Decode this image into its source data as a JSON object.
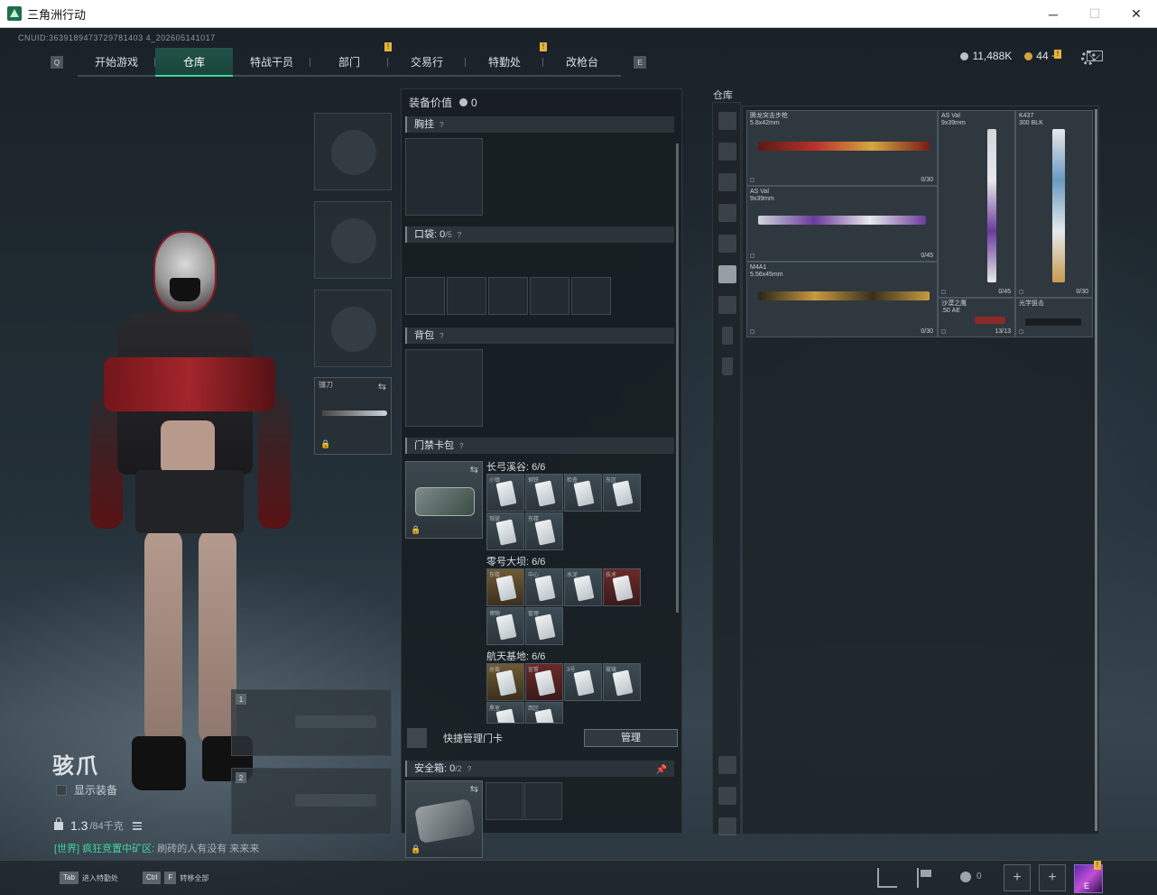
{
  "window": {
    "title": "三角洲行动",
    "minimize": "─",
    "maximize": "☐",
    "close": "✕"
  },
  "uid": "CNUID:3639189473729781403 4_202605141017",
  "nav": {
    "prev_key": "Q",
    "next_key": "E",
    "tabs": [
      {
        "label": "开始游戏",
        "active": false,
        "badge": ""
      },
      {
        "label": "仓库",
        "active": true,
        "badge": ""
      },
      {
        "label": "特战干员",
        "active": false,
        "badge": ""
      },
      {
        "label": "部门",
        "active": false,
        "badge": "!"
      },
      {
        "label": "交易行",
        "active": false,
        "badge": ""
      },
      {
        "label": "特勤处",
        "active": false,
        "badge": "!"
      },
      {
        "label": "改枪台",
        "active": false,
        "badge": ""
      }
    ]
  },
  "currency": {
    "silver": "11,488K",
    "gold": "44",
    "gold_add": "+",
    "mail_badge": "!"
  },
  "character": {
    "name": "骇爪",
    "show_equip_label": "显示装备",
    "weight_value": "1.3",
    "weight_unit": "/84千克",
    "chat_channel": "[世界] 疯狂竞置中矿区:",
    "chat_text": "刷砖的人有没有  来来来"
  },
  "equipment": {
    "melee_label": "镰刀",
    "melee_swap": "⇆",
    "lock": "🔒",
    "gun_slot_1": "1",
    "gun_slot_2": "2"
  },
  "loadout": {
    "value_label": "装备价值",
    "value": "0",
    "chest_label": "胸挂",
    "pocket_label": "口袋:",
    "pocket_count": "0",
    "pocket_cap": "/5",
    "backpack_label": "背包",
    "cardbag_label": "门禁卡包",
    "question": "?",
    "maps": [
      {
        "title": "长弓溪谷: 6/6"
      },
      {
        "title": "零号大坝: 6/6"
      },
      {
        "title": "航天基地: 6/6"
      }
    ],
    "card_labels_1": [
      "小镇",
      "钢铁",
      "检查",
      "东区",
      "驾驶",
      "东楼"
    ],
    "card_labels_2": [
      "东楼",
      "中心",
      "水泥",
      "技术",
      "博物",
      "管理"
    ],
    "card_labels_3": [
      "总裁",
      "宣誓",
      "3号",
      "玻璃",
      "黑室",
      "西区"
    ],
    "quick_manage_label": "快捷管理门卡",
    "manage_button": "管理",
    "safe_label": "安全箱:",
    "safe_count": "0",
    "safe_cap": "/2",
    "pin": "📌"
  },
  "warehouse": {
    "title": "仓库",
    "weapons": [
      {
        "name": "腾龙突击步枪\n5.8x42mm",
        "ammo": "0/30"
      },
      {
        "name": "AS Val\n9x39mm",
        "ammo": "0/45"
      },
      {
        "name": "AS Val\n9x39mm",
        "ammo": "0/45"
      },
      {
        "name": "K437\n300 BLK",
        "ammo": "0/30"
      },
      {
        "name": "M4A1\n5.56x45mm",
        "ammo": "0/30"
      },
      {
        "name": "沙漠之鹰\n.50 AE",
        "ammo": "13/13"
      },
      {
        "name": "光学狙击",
        "ammo": ""
      }
    ]
  },
  "bottom": {
    "hint1_key": "Tab",
    "hint1_text": "进入特勤处",
    "hint2_key1": "Ctrl",
    "hint2_key2": "F",
    "hint2_text": "转移全部",
    "people_count": "0",
    "plus": "+",
    "avatar_badge": "!",
    "avatar_level": "E"
  },
  "colors": {
    "accent": "#3ed6a0",
    "badge": "#e6b33a"
  }
}
